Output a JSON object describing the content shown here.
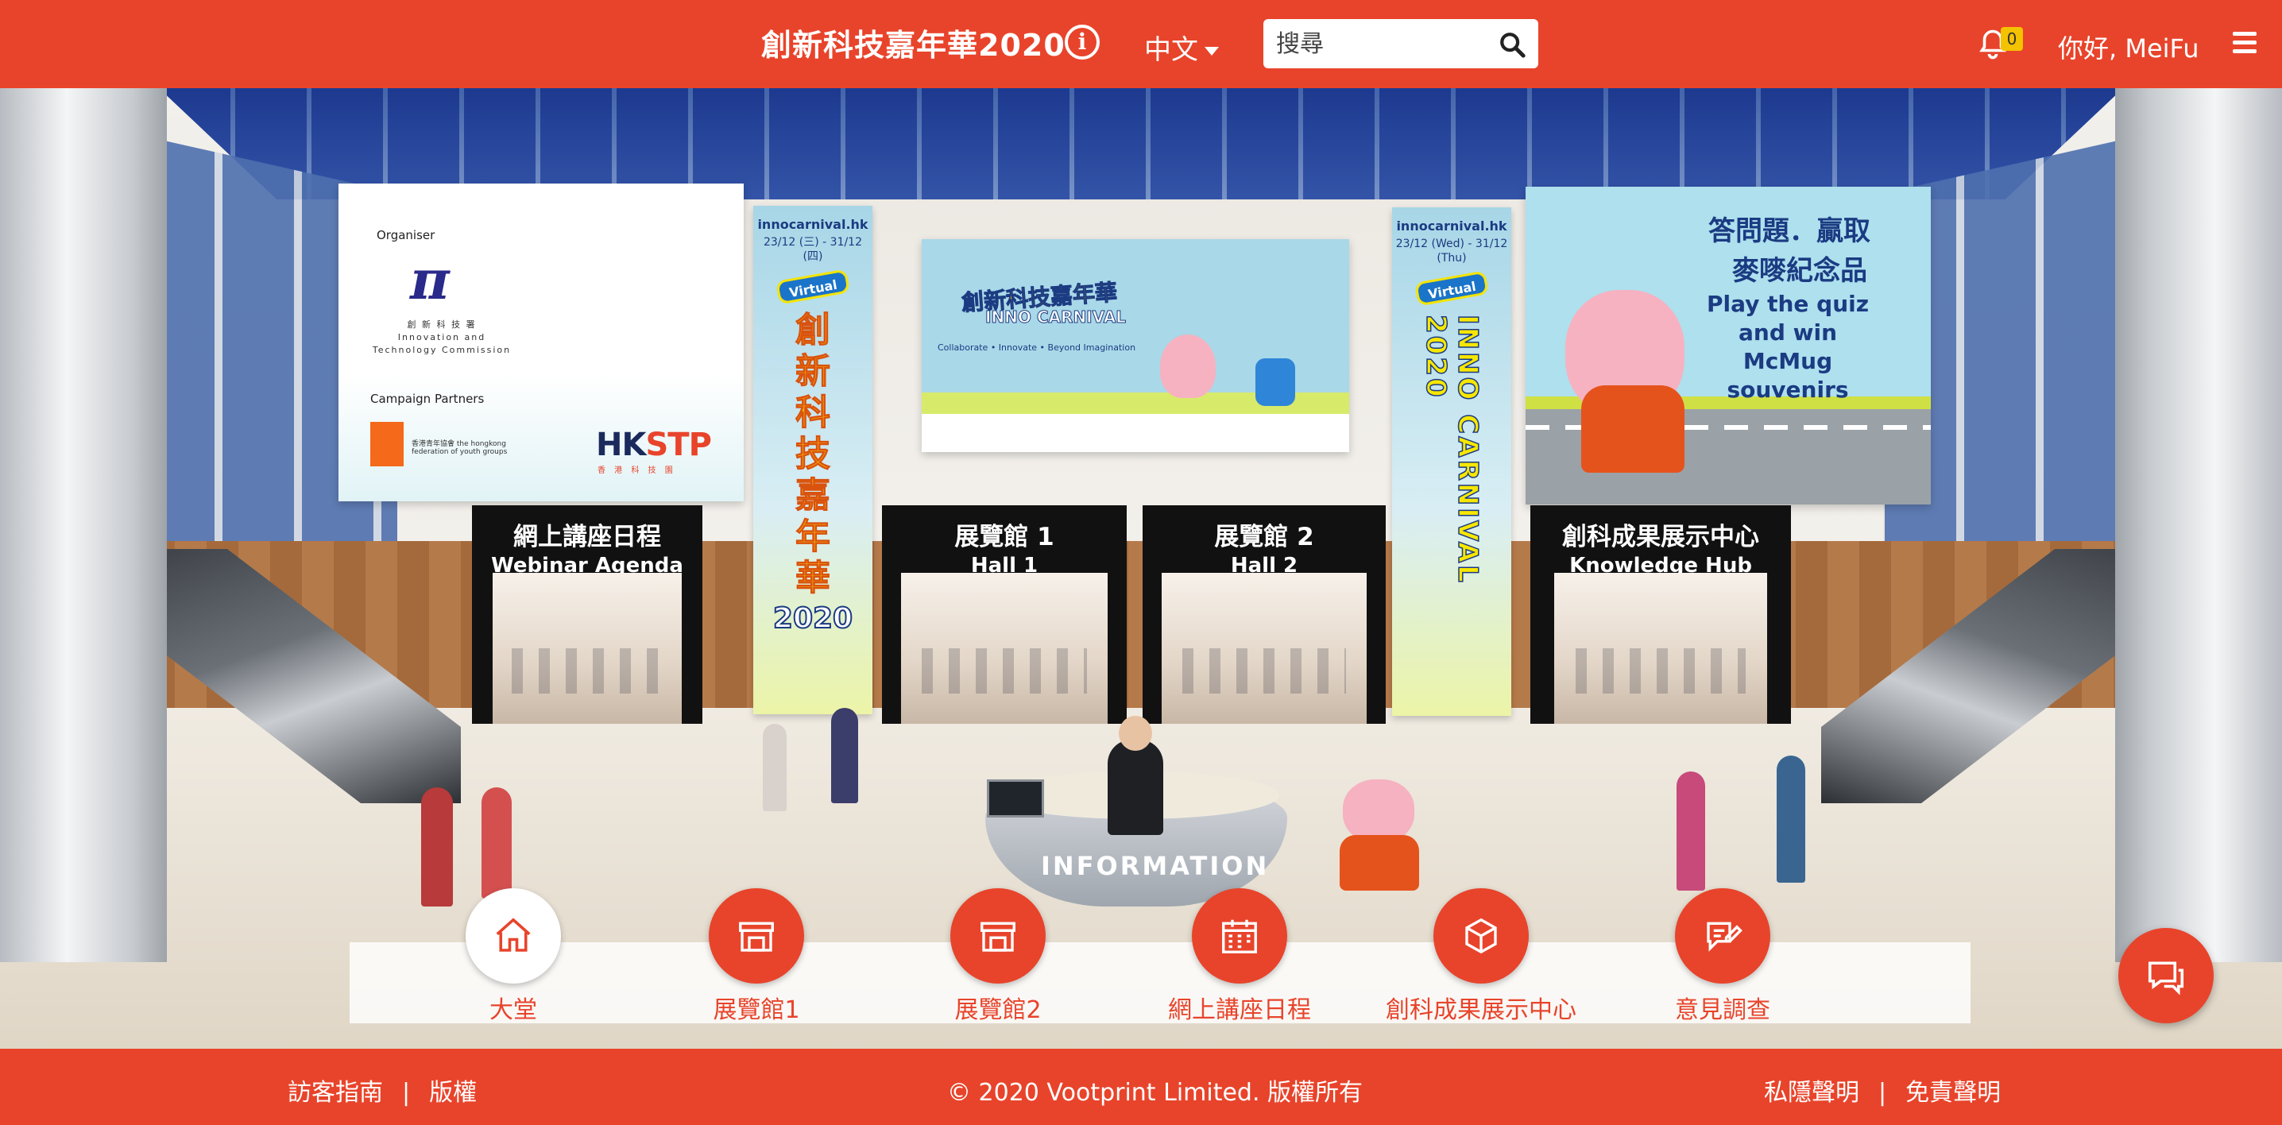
{
  "header": {
    "title": "創新科技嘉年華2020",
    "info_icon": "info-circle-icon",
    "language": "中文",
    "search_placeholder": "搜尋",
    "notification_count": "0",
    "greeting": "你好, MeiFu"
  },
  "scene": {
    "sponsor_panel": {
      "organiser_label": "Organiser",
      "organiser_name_zh": "創 新 科 技 署",
      "organiser_name_en": "Innovation and Technology Commission",
      "partners_label": "Campaign Partners",
      "partner1": "香港青年協會 the hongkong federation of youth groups",
      "partner2_zh": "香 港 科 技 園"
    },
    "banner_left": {
      "url": "innocarnival.hk",
      "date": "23/12 (三) - 31/12 (四)",
      "virtual": "Virtual",
      "title_zh": "創新科技嘉年華",
      "year": "2020"
    },
    "banner_right": {
      "url": "innocarnival.hk",
      "date": "23/12 (Wed) - 31/12 (Thu)",
      "virtual": "Virtual",
      "title_en": "INNO CARNIVAL 2020"
    },
    "center_banner": {
      "title_zh": "創新科技嘉年華",
      "title_en": "INNO CARNIVAL",
      "tagline": "Collaborate • Innovate • Beyond Imagination"
    },
    "quiz_banner": {
      "zh_line1": "答問題．贏取",
      "zh_line2": "麥嘜紀念品",
      "en": "Play the quiz and win McMug souvenirs"
    },
    "doors": [
      {
        "zh": "網上講座日程",
        "en": "Webinar Agenda"
      },
      {
        "zh": "展覽館 1",
        "en": "Hall 1"
      },
      {
        "zh": "展覽館 2",
        "en": "Hall 2"
      },
      {
        "zh": "創科成果展示中心",
        "en": "Knowledge Hub"
      }
    ],
    "info_desk": "INFORMATION"
  },
  "nav": [
    {
      "label": "大堂",
      "icon": "home-icon",
      "active": true
    },
    {
      "label": "展覽館1",
      "icon": "booth-icon"
    },
    {
      "label": "展覽館2",
      "icon": "booth-icon"
    },
    {
      "label": "網上講座日程",
      "icon": "calendar-icon"
    },
    {
      "label": "創科成果展示中心",
      "icon": "cube-icon"
    },
    {
      "label": "意見調查",
      "icon": "survey-icon"
    }
  ],
  "chat_icon": "chat-icon",
  "footer": {
    "guide": "訪客指南",
    "copyright_link": "版權",
    "copyright": "© 2020 Vootprint Limited. 版權所有",
    "privacy": "私隱聲明",
    "disclaimer": "免責聲明",
    "separator": "|"
  },
  "colors": {
    "brand_red": "#e8442b",
    "badge_yellow": "#f3c200"
  }
}
